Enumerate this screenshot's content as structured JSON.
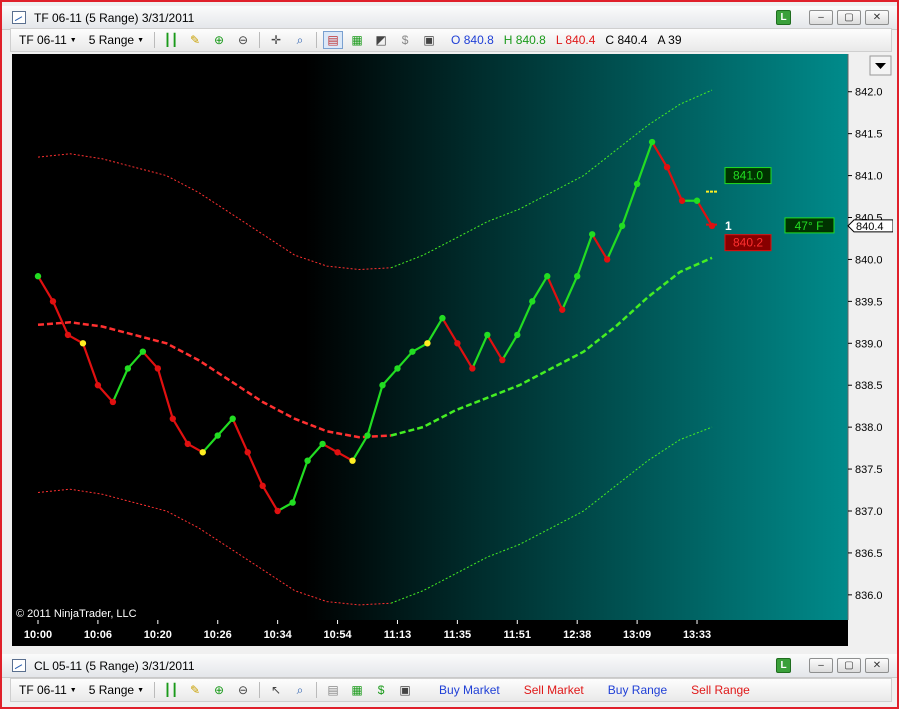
{
  "top_window": {
    "title": "TF 06-11  (5 Range)  3/31/2011",
    "toolbar": {
      "instrument": "TF 06-11",
      "interval": "5 Range",
      "ohlc": {
        "o_label": "O",
        "o_value": "840.8",
        "h_label": "H",
        "h_value": "840.8",
        "l_label": "L",
        "l_value": "840.4",
        "c_label": "C",
        "c_value": "840.4",
        "a_label": "A",
        "a_value": "39"
      }
    }
  },
  "bottom_window": {
    "title": "CL 05-11  (5 Range)  3/31/2011",
    "toolbar": {
      "instrument": "TF 06-11",
      "interval": "5 Range",
      "buy_market": "Buy Market",
      "sell_market": "Sell Market",
      "buy_range": "Buy Range",
      "sell_range": "Sell Range"
    }
  },
  "window_buttons": {
    "link": "L",
    "minimize": "–",
    "maximize": "▢",
    "close": "✕"
  },
  "chart_data": {
    "type": "line",
    "copyright": "© 2011 NinjaTrader, LLC",
    "x_tick_labels": [
      "10:00",
      "10:06",
      "10:20",
      "10:26",
      "10:34",
      "10:54",
      "11:13",
      "11:35",
      "11:51",
      "12:38",
      "13:09",
      "13:33"
    ],
    "y_tick_labels": [
      "842.0",
      "841.5",
      "841.0",
      "840.5",
      "840.0",
      "839.5",
      "839.0",
      "838.5",
      "838.0",
      "837.5",
      "837.0",
      "836.5",
      "836.0"
    ],
    "ylim": [
      835.7,
      842.45
    ],
    "last_price": "840.4",
    "price_tags": {
      "upper": "841.0",
      "lower": "840.2",
      "temperature": "47°  F",
      "counter": "1"
    },
    "colors": {
      "up": "#22dd22",
      "down": "#e01010",
      "neutral": "#ffee22",
      "band": "#ff3030",
      "band_up": "#44ee22",
      "bg_right": "#008b8b"
    },
    "series": [
      {
        "values": [
          839.8,
          839.5,
          839.1,
          839.0,
          838.5,
          838.3,
          838.7,
          838.9,
          838.7,
          838.1,
          837.8,
          837.7,
          837.9,
          838.1,
          837.7,
          837.3,
          837.0,
          837.1,
          837.6,
          837.8,
          837.7,
          837.6,
          837.9,
          838.5,
          838.7,
          838.9,
          839.0,
          839.3,
          839.0,
          838.7,
          839.1,
          838.8,
          839.1,
          839.5,
          839.8,
          839.4,
          839.8,
          840.3,
          840.0,
          840.4,
          840.9,
          841.4,
          841.1,
          840.7,
          840.7,
          840.4
        ]
      },
      {
        "values": [
          839.22,
          839.25,
          839.2,
          839.1,
          839.0,
          838.8,
          838.55,
          838.3,
          838.1,
          837.95,
          837.88,
          837.9,
          838.0,
          838.2,
          838.35,
          838.5,
          838.7,
          838.9,
          839.2,
          839.55,
          839.85,
          840.02
        ]
      },
      {
        "values": [
          841.22,
          841.26,
          841.2,
          841.1,
          841.0,
          840.8,
          840.55,
          840.3,
          840.05,
          839.92,
          839.88,
          839.9,
          840.05,
          840.25,
          840.45,
          840.6,
          840.8,
          841.0,
          841.3,
          841.6,
          841.85,
          842.02
        ]
      },
      {
        "values": [
          837.22,
          837.26,
          837.2,
          837.1,
          837.0,
          836.8,
          836.55,
          836.3,
          836.05,
          835.92,
          835.88,
          835.9,
          836.05,
          836.25,
          836.45,
          836.6,
          836.8,
          837.0,
          837.3,
          837.6,
          837.85,
          838.0
        ]
      }
    ],
    "dot_colors": [
      "g",
      "r",
      "r",
      "y",
      "r",
      "r",
      "g",
      "g",
      "r",
      "r",
      "r",
      "y",
      "g",
      "g",
      "r",
      "r",
      "r",
      "g",
      "g",
      "g",
      "r",
      "y",
      "g",
      "g",
      "g",
      "g",
      "y",
      "g",
      "r",
      "r",
      "g",
      "r",
      "g",
      "g",
      "g",
      "r",
      "g",
      "g",
      "r",
      "g",
      "g",
      "g",
      "r",
      "r",
      "g",
      "r"
    ]
  }
}
